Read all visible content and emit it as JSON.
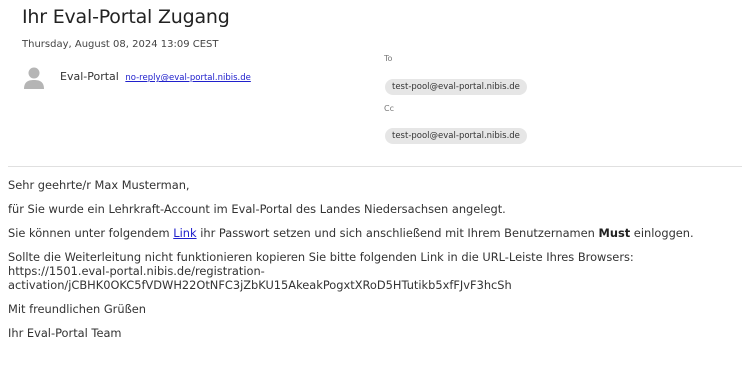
{
  "email": {
    "subject": "Ihr Eval-Portal Zugang",
    "date": "Thursday, August 08, 2024 13:09 CEST",
    "sender_name": "Eval-Portal",
    "sender_email": "no-reply@eval-portal.nibis.de",
    "to_label": "To",
    "to_address": "test-pool@eval-portal.nibis.de",
    "cc_label": "Cc",
    "cc_address": "test-pool@eval-portal.nibis.de",
    "avatar_icon": "user-icon"
  },
  "body": {
    "greeting": "Sehr geehrte/r Max Musterman,",
    "p1": "für Sie wurde ein Lehrkraft-Account im Eval-Portal des Landes Niedersachsen angelegt.",
    "p2_before_link": "Sie können unter folgendem ",
    "p2_link": "Link",
    "p2_middle": " ihr Passwort setzen und sich anschließend mit Ihrem Benutzernamen ",
    "p2_username": "Must",
    "p2_after": " einloggen.",
    "p3_intro": "Sollte die Weiterleitung nicht funktionieren kopieren Sie bitte folgenden Link in die URL-Leiste Ihres Browsers:",
    "p3_url_line1": "https://1501.eval-portal.nibis.de/registration-",
    "p3_url_line2": "activation/jCBHK0OKC5fVDWH22OtNFC3jZbKU15AkeakPogxtXRoD5HTutikb5xfFJvF3hcSh",
    "closing": "Mit freundlichen Grüßen",
    "signature": "Ihr Eval-Portal Team"
  }
}
